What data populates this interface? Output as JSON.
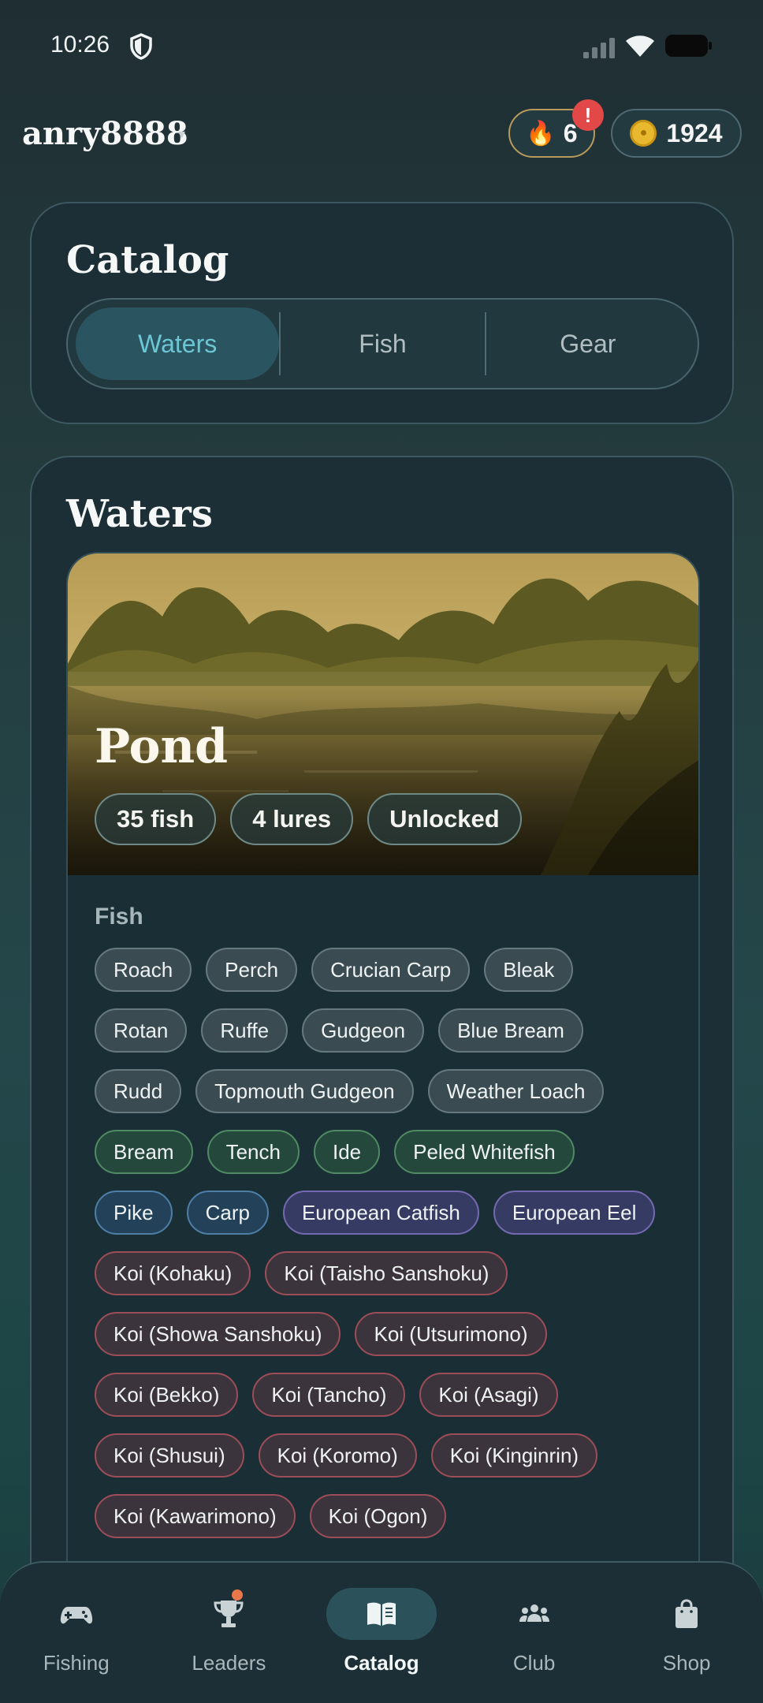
{
  "status_bar": {
    "time": "10:26",
    "icons": [
      "shield-icon",
      "signal-icon",
      "wifi-icon",
      "battery-icon"
    ]
  },
  "header": {
    "username": "anry8888",
    "dropdown_glyph": "▾",
    "streak": {
      "icon": "flame-icon",
      "glyph": "🔥",
      "value": "6",
      "alert": "!"
    },
    "coins": {
      "icon": "coin-icon",
      "value": "1924"
    }
  },
  "catalog": {
    "title": "Catalog",
    "tabs": [
      {
        "label": "Waters",
        "active": true
      },
      {
        "label": "Fish",
        "active": false
      },
      {
        "label": "Gear",
        "active": false
      }
    ]
  },
  "waters": {
    "title": "Waters",
    "pond": {
      "name": "Pond",
      "badges": [
        "35 fish",
        "4 lures",
        "Unlocked"
      ],
      "fish_label": "Fish",
      "fish_rows": [
        [
          {
            "name": "Roach",
            "tier": "grey"
          },
          {
            "name": "Perch",
            "tier": "grey"
          },
          {
            "name": "Crucian Carp",
            "tier": "grey"
          },
          {
            "name": "Bleak",
            "tier": "grey"
          }
        ],
        [
          {
            "name": "Rotan",
            "tier": "grey"
          },
          {
            "name": "Ruffe",
            "tier": "grey"
          },
          {
            "name": "Gudgeon",
            "tier": "grey"
          },
          {
            "name": "Blue Bream",
            "tier": "grey"
          }
        ],
        [
          {
            "name": "Rudd",
            "tier": "grey"
          },
          {
            "name": "Topmouth Gudgeon",
            "tier": "grey"
          },
          {
            "name": "Weather Loach",
            "tier": "grey"
          }
        ],
        [
          {
            "name": "Bream",
            "tier": "green"
          },
          {
            "name": "Tench",
            "tier": "green"
          },
          {
            "name": "Ide",
            "tier": "green"
          },
          {
            "name": "Peled Whitefish",
            "tier": "green"
          }
        ],
        [
          {
            "name": "Pike",
            "tier": "blue"
          },
          {
            "name": "Carp",
            "tier": "blue"
          },
          {
            "name": "European Catfish",
            "tier": "purple"
          },
          {
            "name": "European Eel",
            "tier": "purple"
          }
        ],
        [
          {
            "name": "Koi (Kohaku)",
            "tier": "red"
          },
          {
            "name": "Koi (Taisho Sanshoku)",
            "tier": "red"
          }
        ],
        [
          {
            "name": "Koi (Showa Sanshoku)",
            "tier": "red"
          },
          {
            "name": "Koi (Utsurimono)",
            "tier": "red"
          }
        ],
        [
          {
            "name": "Koi (Bekko)",
            "tier": "red"
          },
          {
            "name": "Koi (Tancho)",
            "tier": "red"
          },
          {
            "name": "Koi (Asagi)",
            "tier": "red"
          }
        ],
        [
          {
            "name": "Koi (Shusui)",
            "tier": "red"
          },
          {
            "name": "Koi (Koromo)",
            "tier": "red"
          },
          {
            "name": "Koi (Kinginrin)",
            "tier": "red"
          }
        ],
        [
          {
            "name": "Koi (Kawarimono)",
            "tier": "red"
          },
          {
            "name": "Koi (Ogon)",
            "tier": "red"
          }
        ]
      ]
    }
  },
  "tier_colors": {
    "grey": "#3a4b52",
    "green": "#25483d",
    "blue": "#23425a",
    "purple": "#363b63",
    "red": "#3c343c"
  },
  "accent_color": "#6dc6d4",
  "bottom_nav": [
    {
      "label": "Fishing",
      "icon": "gamepad-icon",
      "active": false
    },
    {
      "label": "Leaders",
      "icon": "trophy-icon",
      "active": false,
      "notification_dot": true
    },
    {
      "label": "Catalog",
      "icon": "book-icon",
      "active": true
    },
    {
      "label": "Club",
      "icon": "group-icon",
      "active": false
    },
    {
      "label": "Shop",
      "icon": "shopping-bag-icon",
      "active": false
    }
  ]
}
